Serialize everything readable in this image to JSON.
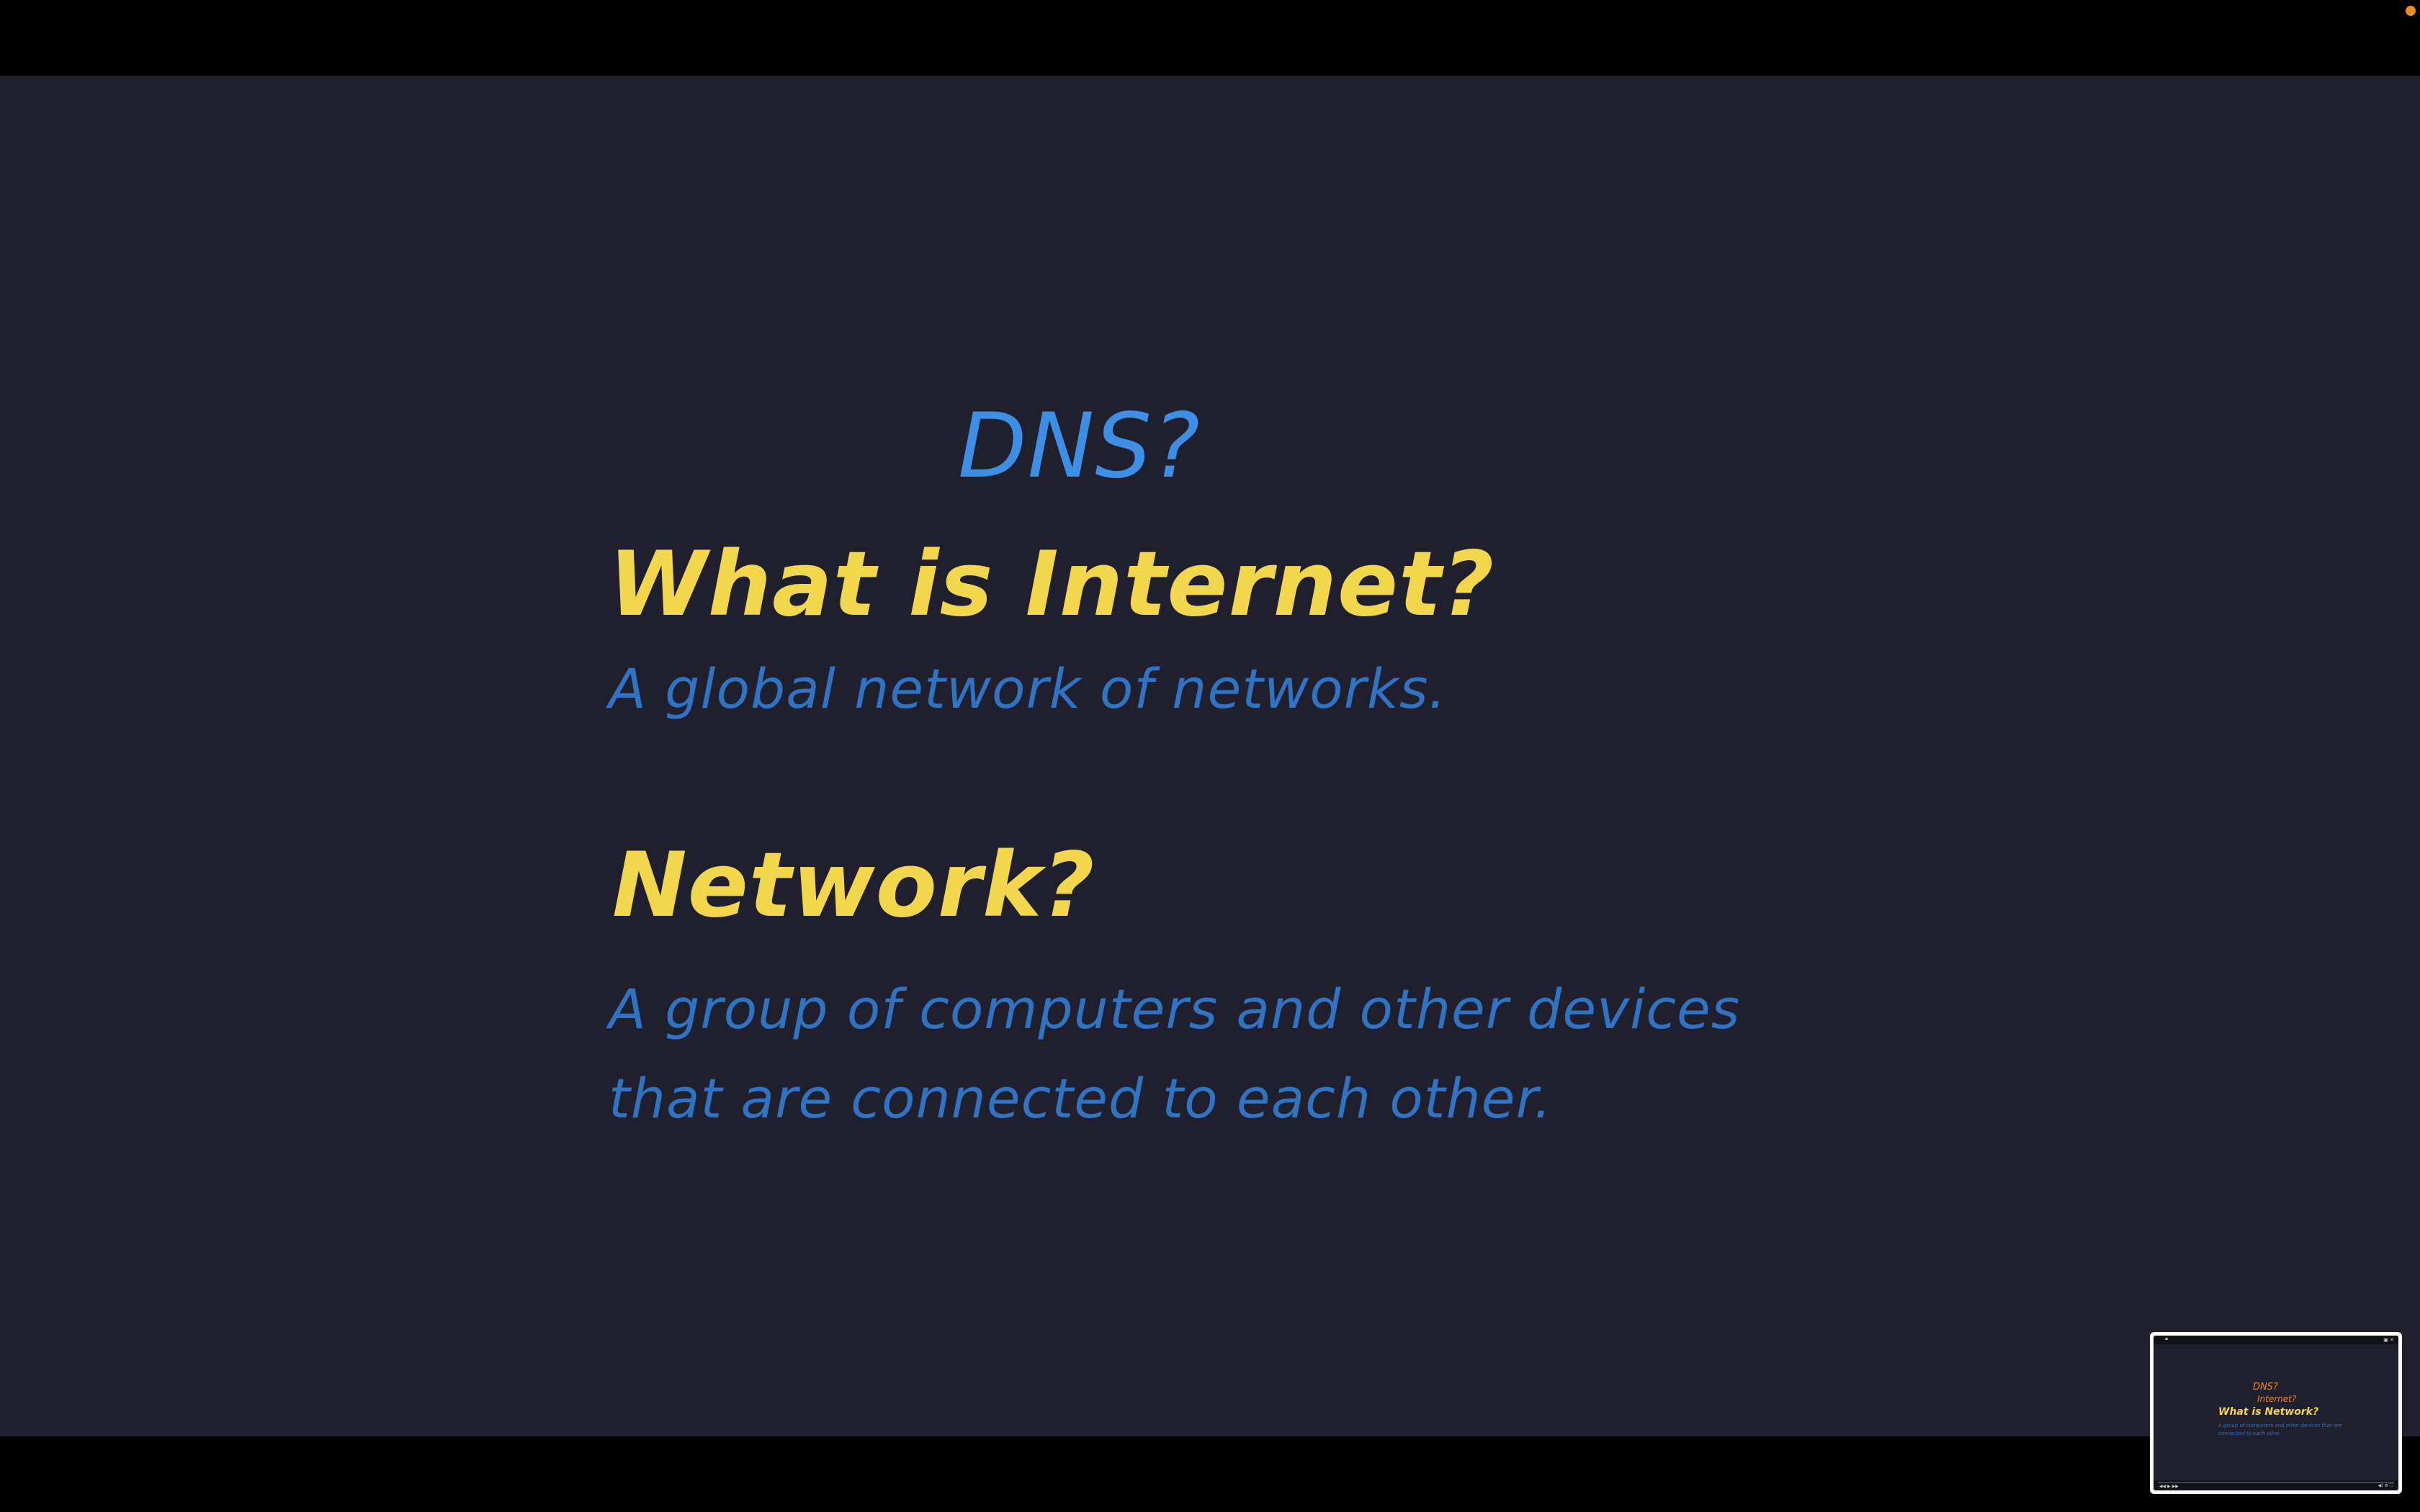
{
  "colors": {
    "background": "#1f1f2e",
    "letterbox": "#000000",
    "title_blue": "#3d8fe6",
    "heading_yellow": "#f2d64b",
    "body_blue": "#2f73c2",
    "pip_orange": "#f08a24",
    "record_indicator": "#f08a24"
  },
  "slide": {
    "title": "DNS?",
    "question1": {
      "heading": "What is Internet?",
      "answer": "A global network of networks."
    },
    "question2": {
      "heading": "Network?",
      "answer": "A group of computers and other devices that are connected to each other."
    }
  },
  "pip_preview": {
    "titlebar_icons": {
      "app": "app-icon",
      "window_controls": "window-controls-icon"
    },
    "title": "DNS?",
    "subtitle": "Internet?",
    "heading": "What is Network?",
    "answer": "A group of computers and other devices that are connected to each other.",
    "control_icons": {
      "left": "playback-controls-icon",
      "right": "player-settings-icon"
    }
  }
}
